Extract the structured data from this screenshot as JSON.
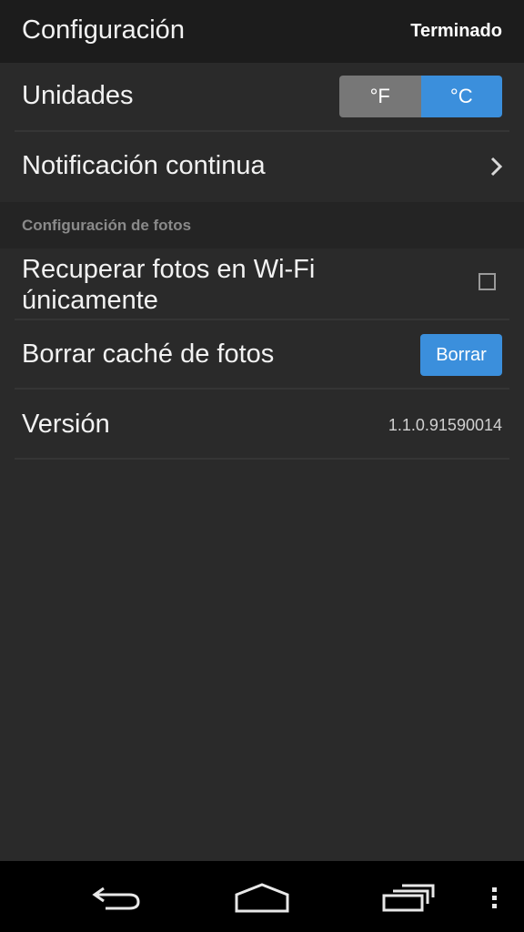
{
  "header": {
    "title": "Configuración",
    "done_label": "Terminado"
  },
  "units": {
    "label": "Unidades",
    "options": [
      "°F",
      "°C"
    ],
    "selected": "°C"
  },
  "notification": {
    "label": "Notificación continua"
  },
  "photos_section": {
    "title": "Configuración de fotos",
    "wifi_only": {
      "label_line1": "Recuperar fotos en Wi-Fi",
      "label_line2": "únicamente",
      "checked": false
    },
    "clear_cache": {
      "label": "Borrar caché de fotos",
      "button_label": "Borrar"
    }
  },
  "version": {
    "label": "Versión",
    "value": "1.1.0.91590014"
  },
  "navbar": {
    "icons": [
      "back-icon",
      "home-icon",
      "recent-apps-icon",
      "overflow-menu-icon"
    ]
  },
  "colors": {
    "accent": "#3b8fdc",
    "background": "#2a2a2a",
    "header_bg": "#1c1c1c",
    "toggle_inactive": "#777777"
  }
}
